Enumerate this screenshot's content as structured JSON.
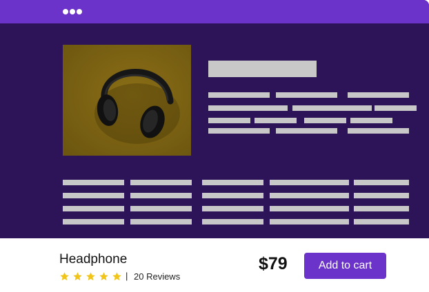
{
  "product": {
    "name": "Headphone",
    "price": "$79",
    "rating": 5,
    "rating_separator": "|",
    "reviews": "20 Reviews",
    "add_to_cart_label": "Add to cart",
    "image_icon": "headphone-photo"
  },
  "colors": {
    "accent": "#6b33c9",
    "window_background": "#2d1459",
    "placeholder": "#c8c8c8",
    "star": "#f0c419"
  }
}
